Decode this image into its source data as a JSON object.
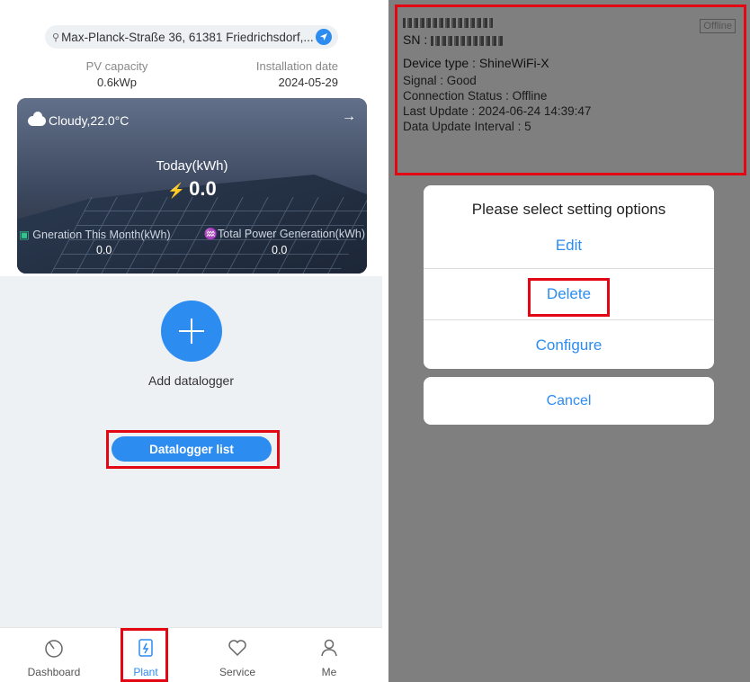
{
  "left": {
    "address": "Max-Planck-Straße 36, 61381 Friedrichsdorf,...",
    "pv_capacity_label": "PV capacity",
    "pv_capacity_value": "0.6kWp",
    "install_label": "Installation date",
    "install_value": "2024-05-29",
    "weather": "Cloudy,22.0°C",
    "today_label": "Today(kWh)",
    "today_value": "0.0",
    "month_label": "Gneration This Month(kWh)",
    "month_value": "0.0",
    "total_label": "Total Power Generation(kWh)",
    "total_value": "0.0",
    "add_label": "Add datalogger",
    "datalogger_list": "Datalogger list",
    "tabs": [
      {
        "label": "Dashboard"
      },
      {
        "label": "Plant"
      },
      {
        "label": "Service"
      },
      {
        "label": "Me"
      }
    ]
  },
  "right": {
    "sn_label": "SN :",
    "offline_badge": "Offline",
    "device_type": "Device type : ShineWiFi-X",
    "signal": "Signal : Good",
    "connection": "Connection Status : Offline",
    "last_update": "Last Update : 2024-06-24 14:39:47",
    "interval": "Data Update Interval : 5",
    "dialog_title": "Please select setting options",
    "edit": "Edit",
    "delete": "Delete",
    "configure": "Configure",
    "cancel": "Cancel"
  },
  "colors": {
    "accent": "#2d8cf0",
    "highlight": "#e30613",
    "green": "#34c38f"
  }
}
